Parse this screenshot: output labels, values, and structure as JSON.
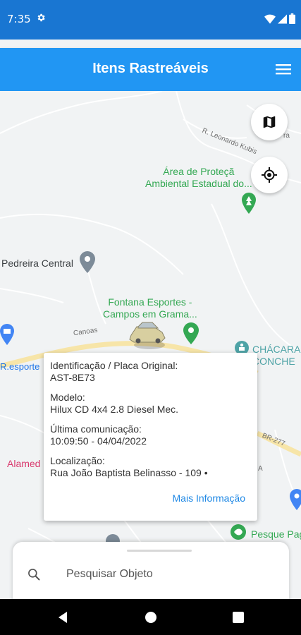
{
  "status_bar": {
    "time": "7:35"
  },
  "app_bar": {
    "title": "Itens Rastreáveis"
  },
  "map": {
    "labels": {
      "area_line1": "Área de Proteçã",
      "area_line2": "Ambiental Estadual do...",
      "pedreira": "Pedreira Central",
      "fontana_line1": "Fontana Esportes -",
      "fontana_line2": "Campos em Grama...",
      "chacara_line1": "CHÁCARA",
      "chacara_line2": "CONCHE",
      "esporte": "R.esporte",
      "alamed": "Alamed",
      "pesque": "Pesque Pag",
      "leonardo_kubis": "R. Leonardo Kubis",
      "canoas": "Canoas",
      "br277": "BR-277",
      "ra": "ra",
      "a": "A"
    }
  },
  "info_window": {
    "id_label": "Identificação / Placa Original:",
    "id_value": "AST-8E73",
    "model_label": "Modelo:",
    "model_value": "Hilux CD 4x4 2.8 Diesel Mec.",
    "last_comm_label": "Última comunicação:",
    "last_comm_value": "10:09:50 - 04/04/2022",
    "location_label": "Localização:",
    "location_value": "Rua João Baptista Belinasso - 109 •",
    "more_link": "Mais Informação"
  },
  "search": {
    "placeholder": "Pesquisar Objeto"
  },
  "icons": {
    "settings": "gear-icon",
    "wifi": "wifi-icon",
    "signal": "signal-icon",
    "battery": "battery-icon",
    "menu": "hamburger-menu-icon",
    "map_type": "map-icon",
    "my_location": "crosshair-icon",
    "search": "search-icon",
    "vehicle": "car-marker-icon"
  },
  "colors": {
    "status_bar": "#1976d2",
    "app_bar": "#2196f3",
    "link": "#1e88e5",
    "map_green": "#34a853",
    "map_pin_gray": "#7d8b98",
    "map_pin_blue": "#4285f4"
  }
}
